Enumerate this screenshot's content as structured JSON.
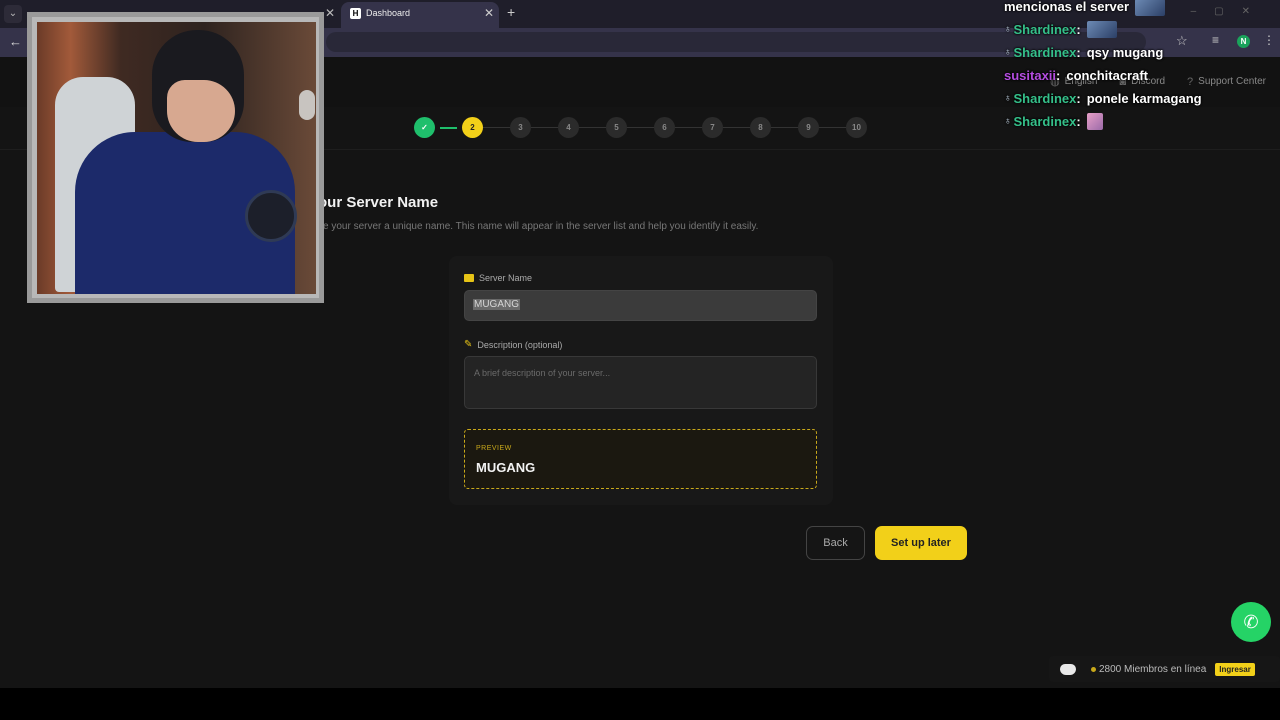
{
  "browser": {
    "active_tab_title": "Dashboard",
    "tab_favicon_letter": "H",
    "profile_initial": "N"
  },
  "header": {
    "links": [
      {
        "icon": "globe-icon",
        "label": "English"
      },
      {
        "icon": "discord-icon",
        "label": "Discord"
      },
      {
        "icon": "help-circle-icon",
        "label": "Support Center"
      }
    ]
  },
  "stepper": {
    "current_step": 2,
    "steps": [
      "✓",
      "2",
      "3",
      "4",
      "5",
      "6",
      "7",
      "8",
      "9",
      "10"
    ]
  },
  "page": {
    "title": "our Server Name",
    "subtitle": "ve your server a unique name. This name will appear in the server list and help you identify it easily."
  },
  "form": {
    "server_name_label": "Server Name",
    "server_name_value": "MUGANG",
    "description_label": "Description (optional)",
    "description_placeholder": "A brief description of your server...",
    "preview_label": "PREVIEW",
    "preview_value": "MUGANG"
  },
  "actions": {
    "back_label": "Back",
    "setup_later_label": "Set up later"
  },
  "discord_widget": {
    "members_text": "2800 Miembros en línea",
    "join_label": "Ingresar"
  },
  "chat": {
    "top_text": "mencionas el server",
    "messages": [
      {
        "user": "Shardinex",
        "color": "#35c08a",
        "text": "",
        "emote": true
      },
      {
        "user": "Shardinex",
        "color": "#35c08a",
        "text": "qsy mugang",
        "emote": false
      },
      {
        "user": "susitaxii",
        "color": "#b44de0",
        "text": "conchitacraft",
        "emote": false
      },
      {
        "user": "Shardinex",
        "color": "#35c08a",
        "text": "ponele karmagang",
        "emote": false
      },
      {
        "user": "Shardinex",
        "color": "#35c08a",
        "text": "",
        "emote": true
      }
    ]
  },
  "colors": {
    "accent_yellow": "#f2d019",
    "done_green": "#1fbf6c",
    "whatsapp_green": "#25d366"
  }
}
